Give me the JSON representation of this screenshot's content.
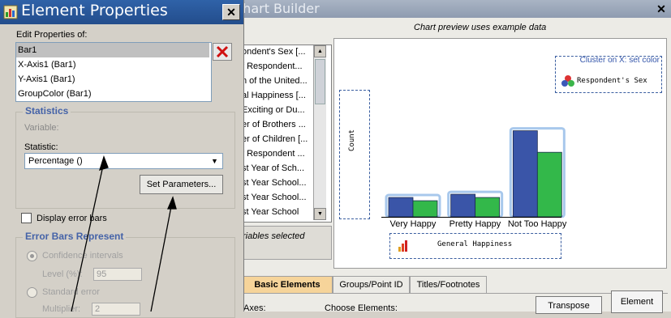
{
  "chart_builder": {
    "title": "Chart Builder",
    "variables": [
      "ondent's Sex [...",
      "f Respondent...",
      "n of the United...",
      "al Happiness [...",
      "Exciting or Du...",
      "er of Brothers ...",
      "er of Children [...",
      "f Respondent ...",
      "st Year of Sch...",
      "st Year School...",
      "st Year School...",
      "st Year School"
    ],
    "status": "riables selected",
    "preview_caption": "Chart preview uses example data",
    "count_label": "Count",
    "legend_title": "Cluster on X: set color",
    "legend_label": "Respondent's Sex",
    "xaxis_label": "General Happiness",
    "tabs": [
      "Basic Elements",
      "Groups/Point ID",
      "Titles/Footnotes"
    ],
    "axes_label": "Axes:",
    "choose_label": "Choose Elements:",
    "transpose_label": "Transpose",
    "element_label": "Element"
  },
  "chart_data": {
    "type": "bar",
    "categories": [
      "Very Happy",
      "Pretty Happy",
      "Not Too Happy"
    ],
    "series": [
      {
        "values": [
          18,
          21,
          80
        ]
      },
      {
        "values": [
          15,
          18,
          60
        ]
      }
    ],
    "colors": [
      "#3a55a8",
      "#33b84a"
    ]
  },
  "element_properties": {
    "title": "Element Properties",
    "edit_label": "Edit Properties of:",
    "items": [
      "Bar1",
      "X-Axis1 (Bar1)",
      "Y-Axis1 (Bar1)",
      "GroupColor (Bar1)"
    ],
    "statistics_heading": "Statistics",
    "variable_label": "Variable:",
    "statistic_label": "Statistic:",
    "statistic_value": "Percentage ()",
    "set_parameters": "Set Parameters...",
    "display_error_bars": "Display error bars",
    "error_bars_heading": "Error Bars Represent",
    "confidence_label": "Confidence intervals",
    "level_label": "Level (%):",
    "level_value": "95",
    "standard_error_label": "Standard error",
    "multiplier_label": "Multiplier:",
    "multiplier_value": "2"
  }
}
